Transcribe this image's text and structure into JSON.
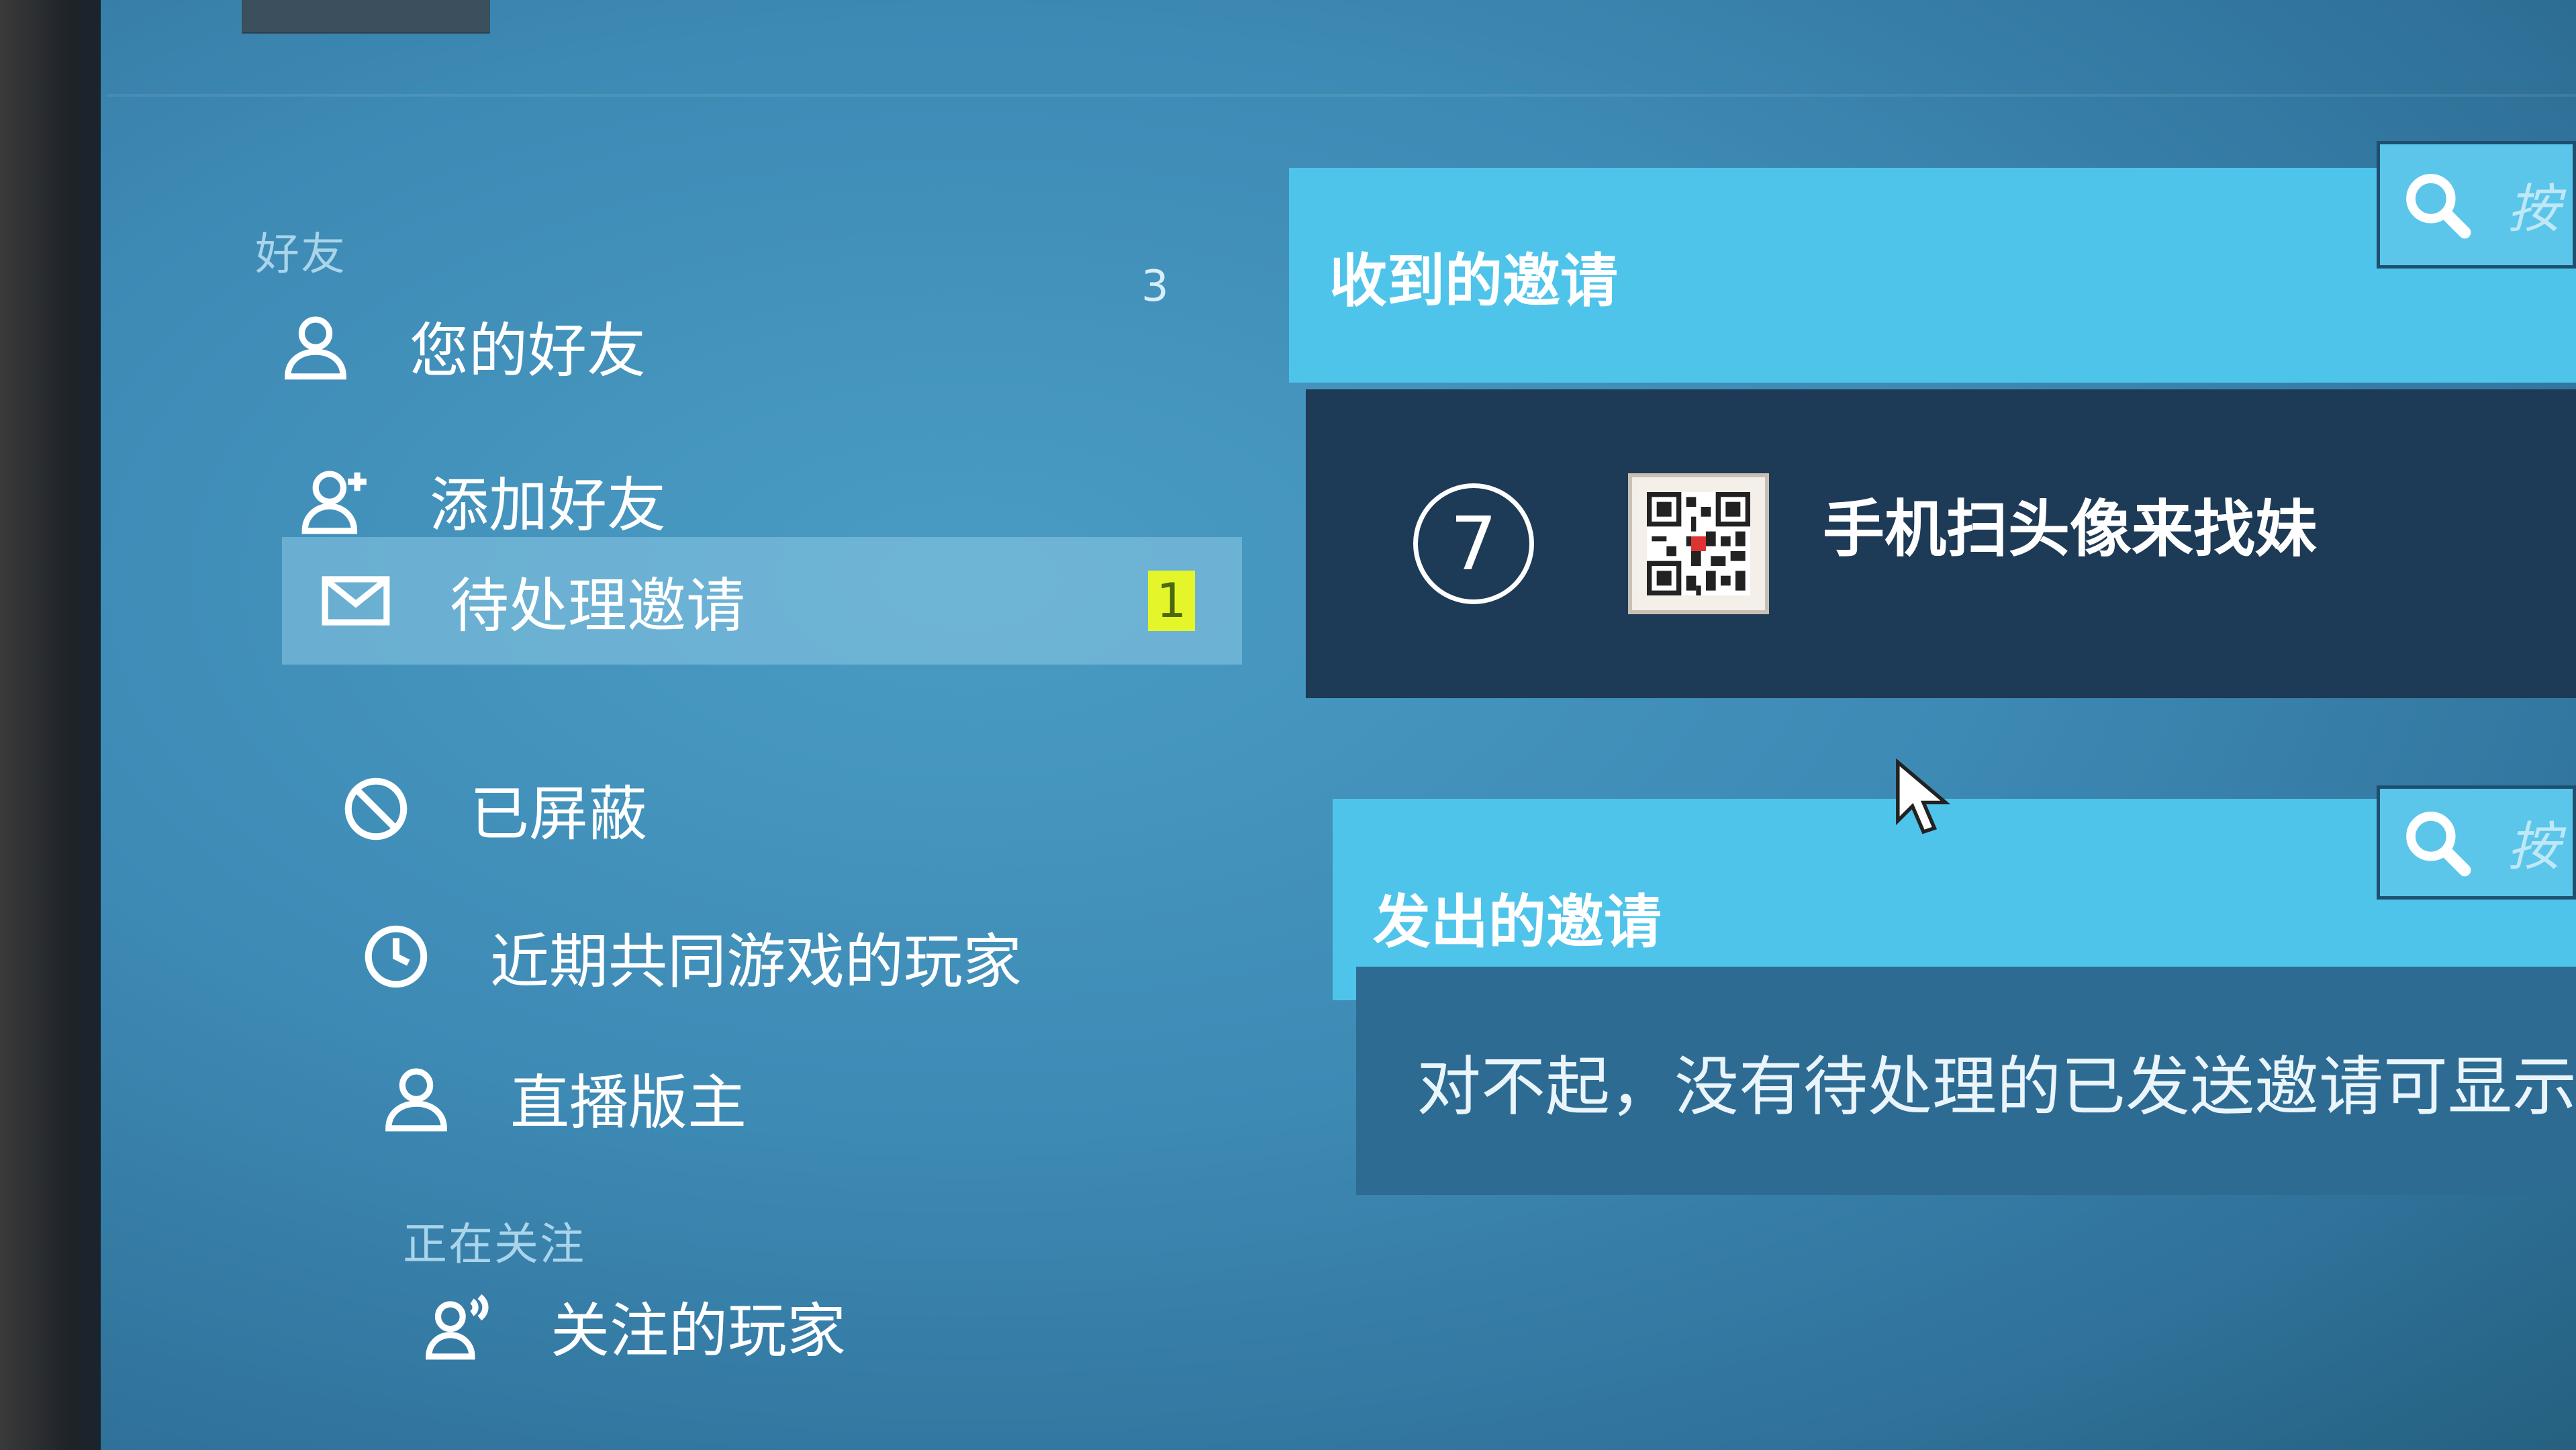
{
  "sidebar": {
    "friends_section": "好友",
    "items": [
      {
        "label": "您的好友",
        "icon": "person-icon",
        "count": "3"
      },
      {
        "label": "添加好友",
        "icon": "add-person-icon"
      },
      {
        "label": "待处理邀请",
        "icon": "envelope-icon",
        "badge": "1",
        "active": true
      },
      {
        "label": "已屏蔽",
        "icon": "blocked-icon"
      },
      {
        "label": "近期共同游戏的玩家",
        "icon": "clock-icon"
      },
      {
        "label": "直播版主",
        "icon": "person-icon"
      }
    ],
    "following_section": "正在关注",
    "following_items": [
      {
        "label": "关注的玩家",
        "icon": "followed-person-icon"
      }
    ]
  },
  "received": {
    "title": "收到的邀请",
    "search_placeholder": "按",
    "invites": [
      {
        "level": "7",
        "name": "手机扫头像来找妹",
        "avatar": "qr-code-avatar"
      }
    ]
  },
  "sent": {
    "title": "发出的邀请",
    "search_placeholder": "按",
    "empty_message": "对不起，没有待处理的已发送邀请可显示"
  },
  "colors": {
    "header": "#4fc4ea",
    "invite_row": "#1d3a56",
    "badge": "#e4f52a"
  }
}
